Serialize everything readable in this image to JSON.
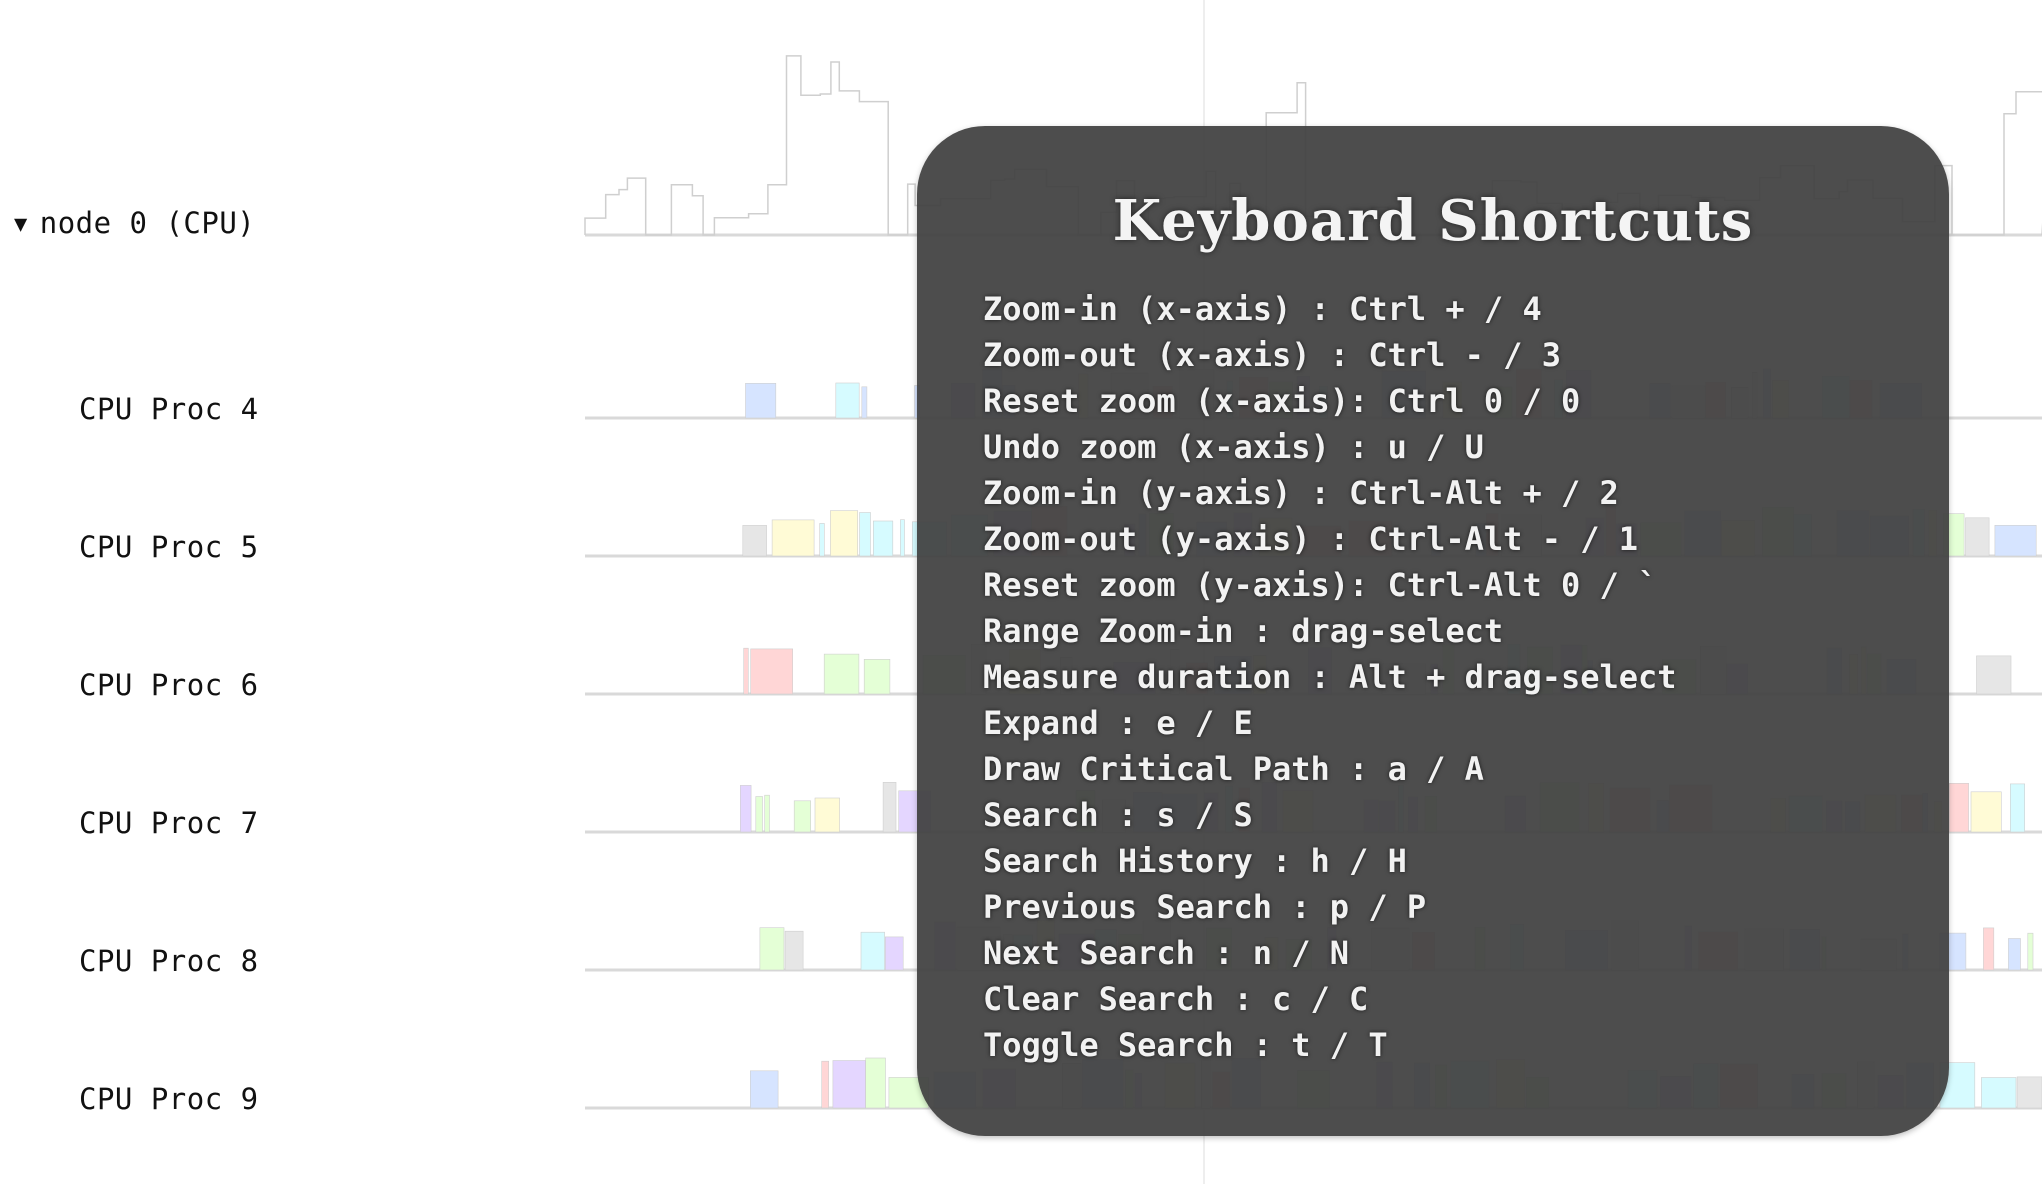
{
  "tree": {
    "node": {
      "label": "node 0 (CPU)",
      "expanded": true,
      "toggle_icon": "triangle-down-icon"
    },
    "processors": [
      {
        "label": "CPU Proc 4"
      },
      {
        "label": "CPU Proc 5"
      },
      {
        "label": "CPU Proc 6"
      },
      {
        "label": "CPU Proc 7"
      },
      {
        "label": "CPU Proc 8"
      },
      {
        "label": "CPU Proc 9"
      }
    ]
  },
  "overlay": {
    "title": "Keyboard Shortcuts",
    "background": "#404040",
    "shortcuts": [
      "Zoom-in (x-axis) : Ctrl + / 4",
      "Zoom-out (x-axis) : Ctrl - / 3",
      "Reset zoom (x-axis): Ctrl 0 / 0",
      "Undo zoom (x-axis) : u / U",
      "Zoom-in (y-axis) : Ctrl-Alt + / 2",
      "Zoom-out (y-axis) : Ctrl-Alt - / 1",
      "Reset zoom (y-axis): Ctrl-Alt 0 / `",
      "Range Zoom-in : drag-select",
      "Measure duration : Alt + drag-select",
      "Expand : e / E",
      "Draw Critical Path : a / A",
      "Search : s / S",
      "Search History : h / H",
      "Previous Search : p / P",
      "Next Search : n / N",
      "Clear Search : c / C",
      "Toggle Search : t / T"
    ]
  },
  "colors": {
    "baseline": "#d9d9d9",
    "utilization_line": "#cfcfcf",
    "task_colors": [
      "#ffd6d6",
      "#e4ffd6",
      "#d6fbff",
      "#e6e6e6",
      "#e4d6ff",
      "#d6e4ff",
      "#fffbd6"
    ]
  }
}
